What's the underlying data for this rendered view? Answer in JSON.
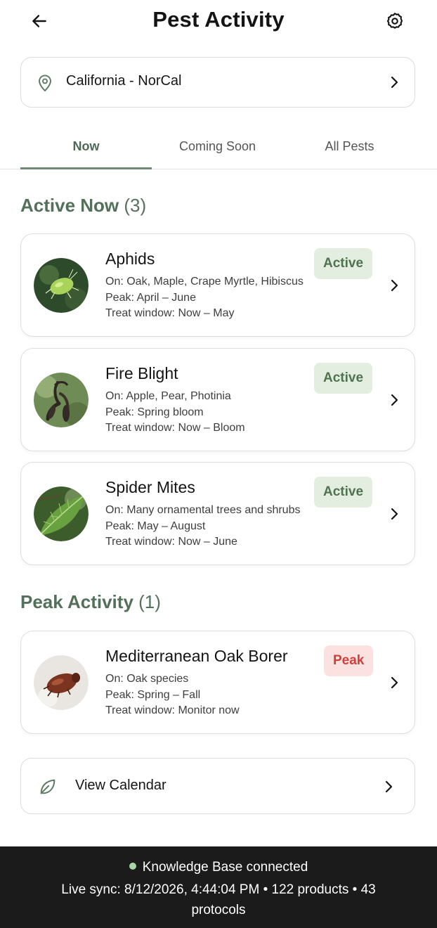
{
  "header": {
    "title": "Pest Activity",
    "back_icon": "arrow-left-icon",
    "settings_icon": "gear-icon"
  },
  "location": {
    "label": "California - NorCal",
    "icon": "map-pin-icon"
  },
  "tabs": [
    {
      "label": "Now",
      "active": true
    },
    {
      "label": "Coming Soon",
      "active": false
    },
    {
      "label": "All Pests",
      "active": false
    }
  ],
  "sections": {
    "active": {
      "title": "Active Now",
      "count": "(3)"
    },
    "peak": {
      "title": "Peak Activity",
      "count": "(1)"
    }
  },
  "pests": [
    {
      "name": "Aphids",
      "hosts": "On: Oak, Maple, Crape Myrtle, Hibiscus",
      "peak": "Peak: April – June",
      "window": "Treat window: Now – May",
      "badge": "Active"
    },
    {
      "name": "Fire Blight",
      "hosts": "On: Apple, Pear, Photinia",
      "peak": "Peak: Spring bloom",
      "window": "Treat window: Now – Bloom",
      "badge": "Active"
    },
    {
      "name": "Spider Mites",
      "hosts": "On: Many ornamental trees and shrubs",
      "peak": "Peak: May – August",
      "window": "Treat window: Now – June",
      "badge": "Active"
    },
    {
      "name": "Mediterranean Oak Borer",
      "hosts": "On: Oak species",
      "peak": "Peak: Spring – Fall",
      "window": "Treat window: Monitor now",
      "badge": "Peak"
    }
  ],
  "calendar": {
    "label": "View Calendar",
    "icon": "leaf-icon"
  },
  "footer": {
    "status": "Knowledge Base connected",
    "sync": "Live sync: 8/12/2026, 4:44:04 PM • 122 products • 43 protocols"
  },
  "colors": {
    "accent": "#53705a",
    "active_badge_bg": "#e4eee0",
    "peak_badge_bg": "#fbe1e0",
    "peak_text": "#cf4039",
    "footer_bg": "#1b1b1b"
  }
}
